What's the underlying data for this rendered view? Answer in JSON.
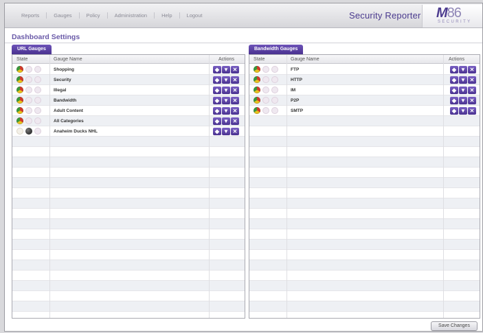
{
  "nav": {
    "items": [
      "Reports",
      "Gauges",
      "Policy",
      "Administration",
      "Help",
      "Logout"
    ]
  },
  "app_title": "Security Reporter",
  "logo": {
    "big_bold": "M",
    "big_rest": "86",
    "small": "SECURITY"
  },
  "page_title": "Dashboard Settings",
  "url_panel": {
    "tab_label": "URL Gauges",
    "headers": {
      "state": "State",
      "name": "Gauge Name",
      "actions": "Actions"
    },
    "rows": [
      {
        "name": "Shopping",
        "state": "color"
      },
      {
        "name": "Security",
        "state": "color"
      },
      {
        "name": "Illegal",
        "state": "color"
      },
      {
        "name": "Bandwidth",
        "state": "color"
      },
      {
        "name": "Adult Content",
        "state": "color"
      },
      {
        "name": "All Categories",
        "state": "color"
      },
      {
        "name": "Anaheim Ducks NHL",
        "state": "dark"
      }
    ]
  },
  "bw_panel": {
    "tab_label": "Bandwidth Gauges",
    "headers": {
      "state": "State",
      "name": "Gauge Name",
      "actions": "Actions"
    },
    "rows": [
      {
        "name": "FTP",
        "state": "color"
      },
      {
        "name": "HTTP",
        "state": "color"
      },
      {
        "name": "IM",
        "state": "color"
      },
      {
        "name": "P2P",
        "state": "color"
      },
      {
        "name": "SMTP",
        "state": "color"
      }
    ]
  },
  "action_icons": [
    "edit-icon",
    "view-icon",
    "delete-icon"
  ],
  "save_button": "Save Changes",
  "colors": {
    "accent": "#4a3290",
    "title": "#6a5aa8"
  }
}
